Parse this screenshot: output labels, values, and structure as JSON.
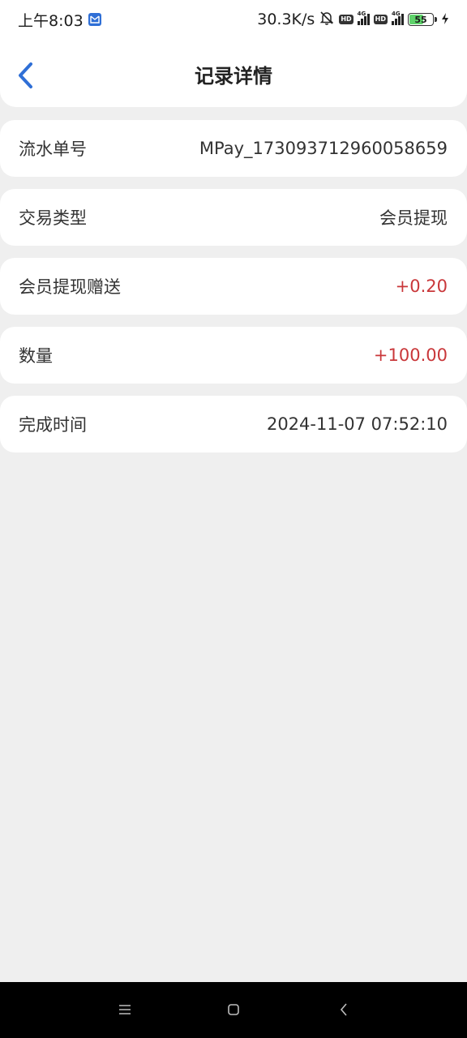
{
  "status_bar": {
    "time": "上午8:03",
    "net_speed": "30.3K/s",
    "hd1": "HD",
    "hd2": "HD",
    "sig1": "4G",
    "sig2": "4G",
    "battery": "55"
  },
  "header": {
    "title": "记录详情"
  },
  "details": [
    {
      "label": "流水单号",
      "value": "MPay_173093712960058659"
    },
    {
      "label": "交易类型",
      "value": "会员提现"
    },
    {
      "label": "会员提现赠送",
      "value": "+0.20"
    },
    {
      "label": "数量",
      "value": "+100.00"
    },
    {
      "label": "完成时间",
      "value": "2024-11-07 07:52:10"
    }
  ],
  "colors": {
    "accent": "#2f6fd6",
    "positive_amount": "#c9373a",
    "background": "#efefef"
  },
  "icons": {
    "back": "chevron-left-icon",
    "mail": "mail-icon",
    "mute": "bell-off-icon",
    "nav_menu": "menu-icon",
    "nav_home": "home-square-icon",
    "nav_back": "back-triangle-icon"
  }
}
